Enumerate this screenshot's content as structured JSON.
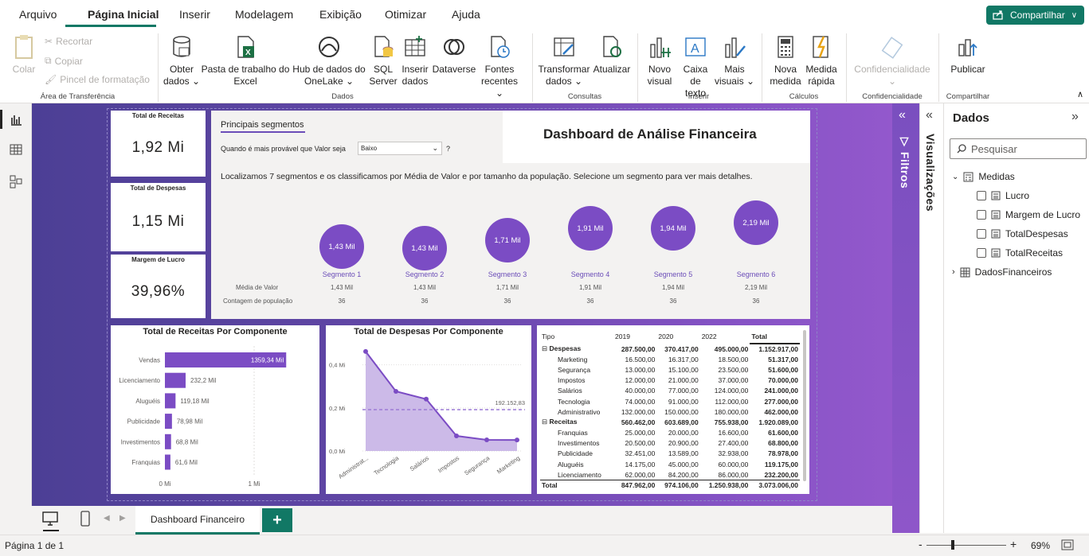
{
  "menu": {
    "items": [
      "Arquivo",
      "Página Inicial",
      "Inserir",
      "Modelagem",
      "Exibição",
      "Otimizar",
      "Ajuda"
    ],
    "share_label": "Compartilhar"
  },
  "ribbon": {
    "clipboard": {
      "paste": "Colar",
      "cut": "Recortar",
      "copy": "Copiar",
      "format_painter": "Pincel de formatação",
      "group": "Área de Transferência"
    },
    "data": {
      "get_data": [
        "Obter",
        "dados"
      ],
      "excel": [
        "Pasta de trabalho do",
        "Excel"
      ],
      "onelake": [
        "Hub de dados do",
        "OneLake"
      ],
      "sql": [
        "SQL",
        "Server"
      ],
      "enter": [
        "Inserir",
        "dados"
      ],
      "dataverse": "Dataverse",
      "recent": [
        "Fontes",
        "recentes"
      ],
      "group": "Dados"
    },
    "queries": {
      "transform": [
        "Transformar",
        "dados"
      ],
      "refresh": "Atualizar",
      "group": "Consultas"
    },
    "insert": {
      "visual": [
        "Novo",
        "visual"
      ],
      "textbox": [
        "Caixa de",
        "texto"
      ],
      "more": [
        "Mais",
        "visuais"
      ],
      "group": "Inserir"
    },
    "calc": {
      "measure": [
        "Nova",
        "medida"
      ],
      "quick": [
        "Medida",
        "rápida"
      ],
      "group": "Cálculos"
    },
    "sensitivity": {
      "label": "Confidencialidade",
      "group": "Confidencialidade"
    },
    "share": {
      "publish": "Publicar",
      "group": "Compartilhar"
    }
  },
  "kpis": [
    {
      "title": "Total de Receitas",
      "value": "1,92 Mi"
    },
    {
      "title": "Total de Despesas",
      "value": "1,15 Mi"
    },
    {
      "title": "Margem de Lucro",
      "value": "39,96%"
    }
  ],
  "segments": {
    "tab": "Principais segmentos",
    "question": "Quando é mais provável que Valor seja",
    "dropdown": "Baixo",
    "help": "?",
    "description": "Localizamos 7 segmentos e os classificamos por Média de Valor e por tamanho da população. Selecione um segmento para ver mais detalhes.",
    "row_avg": "Média de Valor",
    "row_pop": "Contagem de população",
    "items": [
      {
        "bubble": "1,43 Mil",
        "name": "Segmento 1",
        "avg": "1,43 Mil",
        "pop": "36"
      },
      {
        "bubble": "1,43 Mil",
        "name": "Segmento 2",
        "avg": "1,43 Mil",
        "pop": "36"
      },
      {
        "bubble": "1,71 Mil",
        "name": "Segmento 3",
        "avg": "1,71 Mil",
        "pop": "36"
      },
      {
        "bubble": "1,91 Mil",
        "name": "Segmento 4",
        "avg": "1,91 Mil",
        "pop": "36"
      },
      {
        "bubble": "1,94 Mil",
        "name": "Segmento 5",
        "avg": "1,94 Mil",
        "pop": "36"
      },
      {
        "bubble": "2,19 Mil",
        "name": "Segmento 6",
        "avg": "2,19 Mil",
        "pop": "36"
      }
    ]
  },
  "dashboard_title": "Dashboard de Análise Financeira",
  "chart_data": [
    {
      "type": "bar",
      "title": "Total de Receitas Por Componente",
      "categories": [
        "Vendas",
        "Licenciamento",
        "Aluguéis",
        "Publicidade",
        "Investimentos",
        "Franquias"
      ],
      "values": [
        1359.34,
        232.2,
        119.18,
        78.98,
        68.8,
        61.6
      ],
      "data_labels": [
        "1359,34 Mil",
        "232,2 Mil",
        "119,18 Mil",
        "78,98 Mil",
        "68,8 Mil",
        "61,6 Mil"
      ],
      "xticks": [
        "0 Mi",
        "1 Mi"
      ],
      "xlim": [
        0,
        1500
      ],
      "color": "#7b4cc4"
    },
    {
      "type": "area",
      "title": "Total de Despesas Por Componente",
      "categories": [
        "Administrat...",
        "Tecnologia",
        "Salários",
        "Impostos",
        "Segurança",
        "Marketing"
      ],
      "values": [
        462.0,
        277.0,
        241.0,
        70.0,
        51.6,
        51.317
      ],
      "yticks": [
        "0,0 Mi",
        "0,2 Mi",
        "0,4 Mi"
      ],
      "ylim": [
        0,
        480
      ],
      "reference_line": 192.15283,
      "reference_label": "192.152,83",
      "color": "#7b4cc4"
    }
  ],
  "matrix": {
    "headers": [
      "Tipo",
      "2019",
      "2020",
      "2022",
      "Total"
    ],
    "rows": [
      {
        "kind": "group",
        "cells": [
          "Despesas",
          "287.500,00",
          "370.417,00",
          "495.000,00",
          "1.152.917,00"
        ]
      },
      {
        "kind": "sub",
        "cells": [
          "Marketing",
          "16.500,00",
          "16.317,00",
          "18.500,00",
          "51.317,00"
        ]
      },
      {
        "kind": "sub",
        "cells": [
          "Segurança",
          "13.000,00",
          "15.100,00",
          "23.500,00",
          "51.600,00"
        ]
      },
      {
        "kind": "sub",
        "cells": [
          "Impostos",
          "12.000,00",
          "21.000,00",
          "37.000,00",
          "70.000,00"
        ]
      },
      {
        "kind": "sub",
        "cells": [
          "Salários",
          "40.000,00",
          "77.000,00",
          "124.000,00",
          "241.000,00"
        ]
      },
      {
        "kind": "sub",
        "cells": [
          "Tecnologia",
          "74.000,00",
          "91.000,00",
          "112.000,00",
          "277.000,00"
        ]
      },
      {
        "kind": "sub",
        "cells": [
          "Administrativo",
          "132.000,00",
          "150.000,00",
          "180.000,00",
          "462.000,00"
        ]
      },
      {
        "kind": "group",
        "cells": [
          "Receitas",
          "560.462,00",
          "603.689,00",
          "755.938,00",
          "1.920.089,00"
        ]
      },
      {
        "kind": "sub",
        "cells": [
          "Franquias",
          "25.000,00",
          "20.000,00",
          "16.600,00",
          "61.600,00"
        ]
      },
      {
        "kind": "sub",
        "cells": [
          "Investimentos",
          "20.500,00",
          "20.900,00",
          "27.400,00",
          "68.800,00"
        ]
      },
      {
        "kind": "sub",
        "cells": [
          "Publicidade",
          "32.451,00",
          "13.589,00",
          "32.938,00",
          "78.978,00"
        ]
      },
      {
        "kind": "sub",
        "cells": [
          "Aluguéis",
          "14.175,00",
          "45.000,00",
          "60.000,00",
          "119.175,00"
        ]
      },
      {
        "kind": "sub",
        "cells": [
          "Licenciamento",
          "62.000,00",
          "84.200,00",
          "86.000,00",
          "232.200,00"
        ]
      },
      {
        "kind": "total",
        "cells": [
          "Total",
          "847.962,00",
          "974.106,00",
          "1.250.938,00",
          "3.073.006,00"
        ]
      }
    ]
  },
  "panels": {
    "filters": "Filtros",
    "visualizations": "Visualizações",
    "data_title": "Dados",
    "search_placeholder": "Pesquisar",
    "tables": [
      {
        "name": "Medidas",
        "expanded": true,
        "fields": [
          "Lucro",
          "Margem de Lucro",
          "TotalDespesas",
          "TotalReceitas"
        ]
      },
      {
        "name": "DadosFinanceiros",
        "expanded": false,
        "fields": []
      }
    ]
  },
  "tabs": {
    "page": "Dashboard Financeiro",
    "add": "+"
  },
  "status": {
    "page": "Página 1 de 1",
    "zoom": "69%",
    "zoom_minus": "-",
    "zoom_plus": "+"
  }
}
